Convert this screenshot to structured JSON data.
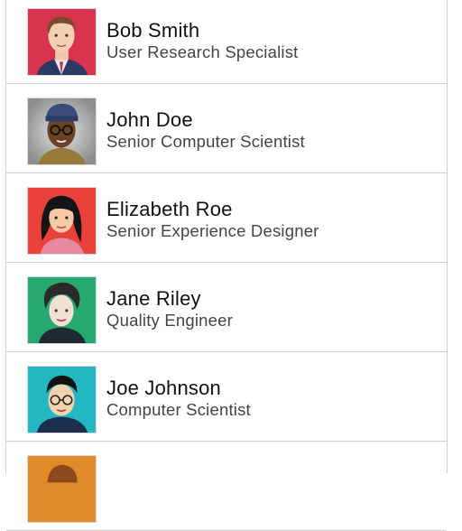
{
  "contacts": [
    {
      "name": "Bob Smith",
      "title": "User Research Specialist",
      "avatar_icon": "man-red-background-avatar",
      "bg": "#d8344f"
    },
    {
      "name": "John Doe",
      "title": "Senior Computer Scientist",
      "avatar_icon": "man-glasses-beanie-avatar",
      "bg": "#b9b9b9"
    },
    {
      "name": "Elizabeth Roe",
      "title": "Senior Experience Designer",
      "avatar_icon": "woman-dark-hair-avatar",
      "bg": "#e8423b"
    },
    {
      "name": "Jane Riley",
      "title": "Quality Engineer",
      "avatar_icon": "woman-curly-hair-avatar",
      "bg": "#27a86e"
    },
    {
      "name": "Joe Johnson",
      "title": "Computer Scientist",
      "avatar_icon": "man-glasses-avatar",
      "bg": "#24b7c2"
    },
    {
      "name": "",
      "title": "",
      "avatar_icon": "partial-avatar",
      "bg": "#e08a2a"
    }
  ]
}
